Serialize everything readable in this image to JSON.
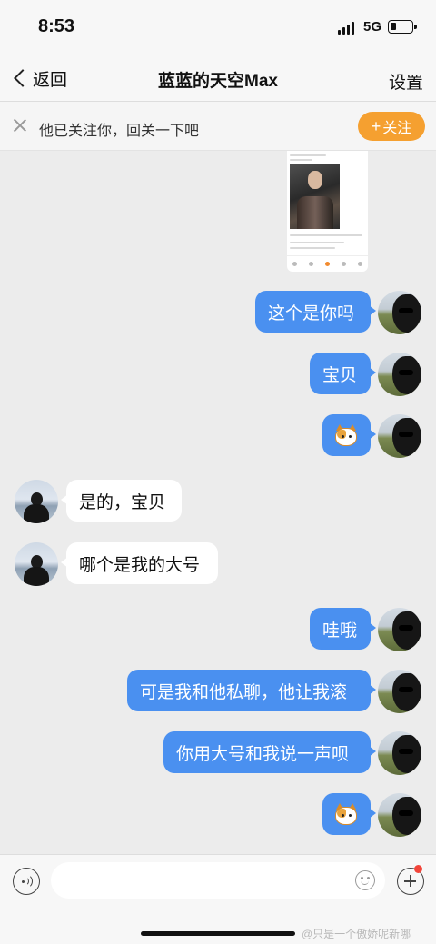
{
  "status": {
    "time": "8:53",
    "network": "5G"
  },
  "nav": {
    "back_label": "返回",
    "title": "蓝蓝的天空Max",
    "settings_label": "设置"
  },
  "banner": {
    "text": "他已关注你，回关一下吧",
    "follow_label": "关注",
    "follow_color": "#f5a030"
  },
  "messages": {
    "m1": "这个是你吗",
    "m2": "宝贝",
    "m4": "是的，宝贝",
    "m5": "哪个是我的大号",
    "m6": "哇哦",
    "m7": "可是我和他私聊，他让我滚",
    "m8": "你用大号和我说一声呗"
  },
  "colors": {
    "outgoing_bubble": "#4a90f0",
    "incoming_bubble": "#ffffff",
    "background": "#ececec"
  },
  "input": {
    "placeholder": ""
  },
  "watermark": "@只是一个傲娇呢新哪"
}
